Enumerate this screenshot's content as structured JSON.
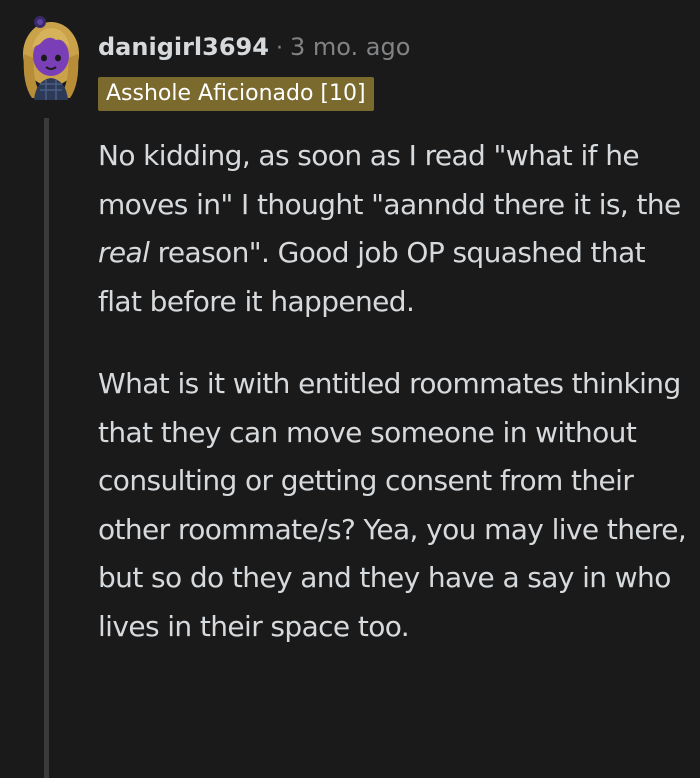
{
  "comment": {
    "username": "danigirl3694",
    "separator": "·",
    "timestamp": "3 mo. ago",
    "flair": "Asshole Aficionado [10]",
    "avatar_icon": "user-avatar-icon",
    "flair_color": "#7b6a2e",
    "background_color": "#1a1a1b",
    "text_color": "#d7dadc",
    "muted_color": "#818384",
    "paragraphs": [
      {
        "pre": "No kidding, as soon as I read \"what if he moves in\" I thought \"aanndd there it is, the ",
        "emphasis": "real",
        "post": " reason\". Good job OP squashed that flat before it happened."
      },
      {
        "text": "What is it with entitled roommates thinking that they can move someone in without consulting or getting consent from their other roommate/s? Yea, you may live there, but so do they and they have a say in who lives in their space too."
      }
    ]
  }
}
